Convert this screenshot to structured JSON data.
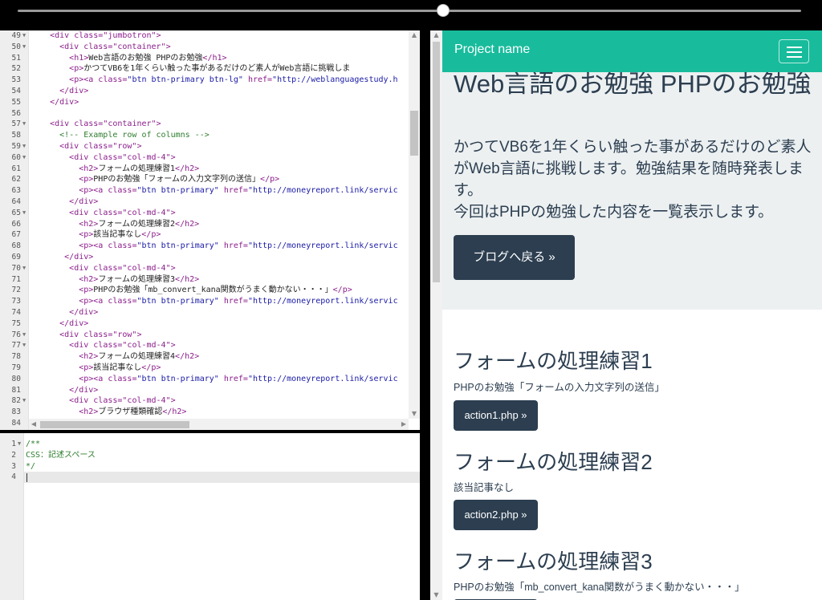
{
  "html_editor": {
    "lines": [
      {
        "n": "49",
        "fold": true,
        "segs": [
          [
            "",
            "    "
          ],
          [
            "tag",
            "<div class=\"jumbotron\">"
          ]
        ]
      },
      {
        "n": "50",
        "fold": true,
        "segs": [
          [
            "",
            "      "
          ],
          [
            "tag",
            "<div class=\"container\">"
          ]
        ]
      },
      {
        "n": "51",
        "fold": false,
        "segs": [
          [
            "",
            "        "
          ],
          [
            "tag",
            "<h1>"
          ],
          [
            "",
            "Web言語のお勉強 PHPのお勉強"
          ],
          [
            "tag",
            "</h1>"
          ]
        ]
      },
      {
        "n": "52",
        "fold": false,
        "segs": [
          [
            "",
            "        "
          ],
          [
            "tag",
            "<p>"
          ],
          [
            "",
            "かつてVB6を1年くらい触った事があるだけのど素人がWeb言語に挑戦しま"
          ]
        ]
      },
      {
        "n": "53",
        "fold": false,
        "segs": [
          [
            "",
            "        "
          ],
          [
            "tag",
            "<p><a class="
          ],
          [
            "str",
            "\"btn btn-primary btn-lg\""
          ],
          [
            "tag",
            " href="
          ],
          [
            "str",
            "\"http://weblanguagestudy.h"
          ]
        ]
      },
      {
        "n": "54",
        "fold": false,
        "segs": [
          [
            "",
            "      "
          ],
          [
            "tag",
            "</div>"
          ]
        ]
      },
      {
        "n": "55",
        "fold": false,
        "segs": [
          [
            "",
            "    "
          ],
          [
            "tag",
            "</div>"
          ]
        ]
      },
      {
        "n": "56",
        "fold": false,
        "segs": [
          [
            "",
            ""
          ]
        ]
      },
      {
        "n": "57",
        "fold": true,
        "segs": [
          [
            "",
            "    "
          ],
          [
            "tag",
            "<div class=\"container\">"
          ]
        ]
      },
      {
        "n": "58",
        "fold": false,
        "segs": [
          [
            "",
            "      "
          ],
          [
            "com",
            "<!-- Example row of columns -->"
          ]
        ]
      },
      {
        "n": "59",
        "fold": true,
        "segs": [
          [
            "",
            "      "
          ],
          [
            "tag",
            "<div class=\"row\">"
          ]
        ]
      },
      {
        "n": "60",
        "fold": true,
        "segs": [
          [
            "",
            "        "
          ],
          [
            "tag",
            "<div class=\"col-md-4\">"
          ]
        ]
      },
      {
        "n": "61",
        "fold": false,
        "segs": [
          [
            "",
            "          "
          ],
          [
            "tag",
            "<h2>"
          ],
          [
            "",
            "フォームの処理練習1"
          ],
          [
            "tag",
            "</h2>"
          ]
        ]
      },
      {
        "n": "62",
        "fold": false,
        "segs": [
          [
            "",
            "          "
          ],
          [
            "tag",
            "<p>"
          ],
          [
            "",
            "PHPのお勉強「フォームの入力文字列の送信」"
          ],
          [
            "tag",
            "</p>"
          ]
        ]
      },
      {
        "n": "63",
        "fold": false,
        "segs": [
          [
            "",
            "          "
          ],
          [
            "tag",
            "<p><a class="
          ],
          [
            "str",
            "\"btn btn-primary\""
          ],
          [
            "tag",
            " href="
          ],
          [
            "str",
            "\"http://moneyreport.link/servic"
          ]
        ]
      },
      {
        "n": "64",
        "fold": false,
        "segs": [
          [
            "",
            "        "
          ],
          [
            "tag",
            "</div>"
          ]
        ]
      },
      {
        "n": "65",
        "fold": true,
        "segs": [
          [
            "",
            "        "
          ],
          [
            "tag",
            "<div class=\"col-md-4\">"
          ]
        ]
      },
      {
        "n": "66",
        "fold": false,
        "segs": [
          [
            "",
            "          "
          ],
          [
            "tag",
            "<h2>"
          ],
          [
            "",
            "フォームの処理練習2"
          ],
          [
            "tag",
            "</h2>"
          ]
        ]
      },
      {
        "n": "67",
        "fold": false,
        "segs": [
          [
            "",
            "          "
          ],
          [
            "tag",
            "<p>"
          ],
          [
            "",
            "該当記事なし"
          ],
          [
            "tag",
            "</p>"
          ]
        ]
      },
      {
        "n": "68",
        "fold": false,
        "segs": [
          [
            "",
            "          "
          ],
          [
            "tag",
            "<p><a class="
          ],
          [
            "str",
            "\"btn btn-primary\""
          ],
          [
            "tag",
            " href="
          ],
          [
            "str",
            "\"http://moneyreport.link/servic"
          ]
        ]
      },
      {
        "n": "69",
        "fold": false,
        "segs": [
          [
            "",
            "       "
          ],
          [
            "tag",
            "</div>"
          ]
        ]
      },
      {
        "n": "70",
        "fold": true,
        "segs": [
          [
            "",
            "        "
          ],
          [
            "tag",
            "<div class=\"col-md-4\">"
          ]
        ]
      },
      {
        "n": "71",
        "fold": false,
        "segs": [
          [
            "",
            "          "
          ],
          [
            "tag",
            "<h2>"
          ],
          [
            "",
            "フォームの処理練習3"
          ],
          [
            "tag",
            "</h2>"
          ]
        ]
      },
      {
        "n": "72",
        "fold": false,
        "segs": [
          [
            "",
            "          "
          ],
          [
            "tag",
            "<p>"
          ],
          [
            "",
            "PHPのお勉強「mb_convert_kana関数がうまく動かない・・・」"
          ],
          [
            "tag",
            "</p>"
          ]
        ]
      },
      {
        "n": "73",
        "fold": false,
        "segs": [
          [
            "",
            "          "
          ],
          [
            "tag",
            "<p><a class="
          ],
          [
            "str",
            "\"btn btn-primary\""
          ],
          [
            "tag",
            " href="
          ],
          [
            "str",
            "\"http://moneyreport.link/servic"
          ]
        ]
      },
      {
        "n": "74",
        "fold": false,
        "segs": [
          [
            "",
            "        "
          ],
          [
            "tag",
            "</div>"
          ]
        ]
      },
      {
        "n": "75",
        "fold": false,
        "segs": [
          [
            "",
            "      "
          ],
          [
            "tag",
            "</div>"
          ]
        ]
      },
      {
        "n": "76",
        "fold": true,
        "segs": [
          [
            "",
            "      "
          ],
          [
            "tag",
            "<div class=\"row\">"
          ]
        ]
      },
      {
        "n": "77",
        "fold": true,
        "segs": [
          [
            "",
            "        "
          ],
          [
            "tag",
            "<div class=\"col-md-4\">"
          ]
        ]
      },
      {
        "n": "78",
        "fold": false,
        "segs": [
          [
            "",
            "          "
          ],
          [
            "tag",
            "<h2>"
          ],
          [
            "",
            "フォームの処理練習4"
          ],
          [
            "tag",
            "</h2>"
          ]
        ]
      },
      {
        "n": "79",
        "fold": false,
        "segs": [
          [
            "",
            "          "
          ],
          [
            "tag",
            "<p>"
          ],
          [
            "",
            "該当記事なし"
          ],
          [
            "tag",
            "</p>"
          ]
        ]
      },
      {
        "n": "80",
        "fold": false,
        "segs": [
          [
            "",
            "          "
          ],
          [
            "tag",
            "<p><a class="
          ],
          [
            "str",
            "\"btn btn-primary\""
          ],
          [
            "tag",
            " href="
          ],
          [
            "str",
            "\"http://moneyreport.link/servic"
          ]
        ]
      },
      {
        "n": "81",
        "fold": false,
        "segs": [
          [
            "",
            "        "
          ],
          [
            "tag",
            "</div>"
          ]
        ]
      },
      {
        "n": "82",
        "fold": true,
        "segs": [
          [
            "",
            "        "
          ],
          [
            "tag",
            "<div class=\"col-md-4\">"
          ]
        ]
      },
      {
        "n": "83",
        "fold": false,
        "segs": [
          [
            "",
            "          "
          ],
          [
            "tag",
            "<h2>"
          ],
          [
            "",
            "ブラウザ種類確認"
          ],
          [
            "tag",
            "</h2>"
          ]
        ]
      },
      {
        "n": "84",
        "fold": false,
        "segs": [
          [
            "",
            ""
          ]
        ]
      }
    ]
  },
  "css_editor": {
    "lines": [
      {
        "n": "1",
        "fold": true,
        "segs": [
          [
            "com",
            "/**"
          ]
        ]
      },
      {
        "n": "2",
        "fold": false,
        "segs": [
          [
            "com",
            "CSS：記述スペース"
          ]
        ]
      },
      {
        "n": "3",
        "fold": false,
        "segs": [
          [
            "com",
            "*/"
          ]
        ]
      },
      {
        "n": "4",
        "fold": false,
        "segs": [
          [
            "",
            ""
          ]
        ]
      }
    ]
  },
  "preview": {
    "brand": "Project name",
    "jumbotron": {
      "title": "Web言語のお勉強 PHPのお勉強",
      "text_line1": "かつてVB6を1年くらい触った事があるだけのど素人がWeb言語に挑戦します。勉強結果を随時発表します。",
      "text_line2": "今回はPHPの勉強した内容を一覧表示します。",
      "button": "ブログへ戻る »"
    },
    "features": [
      {
        "heading": "フォームの処理練習1",
        "text": "PHPのお勉強「フォームの入力文字列の送信」",
        "button": "action1.php »"
      },
      {
        "heading": "フォームの処理練習2",
        "text": "該当記事なし",
        "button": "action2.php »"
      },
      {
        "heading": "フォームの処理練習3",
        "text": "PHPのお勉強「mb_convert_kana関数がうまく動かない・・・」",
        "button": ""
      }
    ]
  },
  "colors": {
    "navbar": "#18bc9c",
    "primary": "#2c3e50",
    "jumbotron_bg": "#ecf0f1"
  }
}
